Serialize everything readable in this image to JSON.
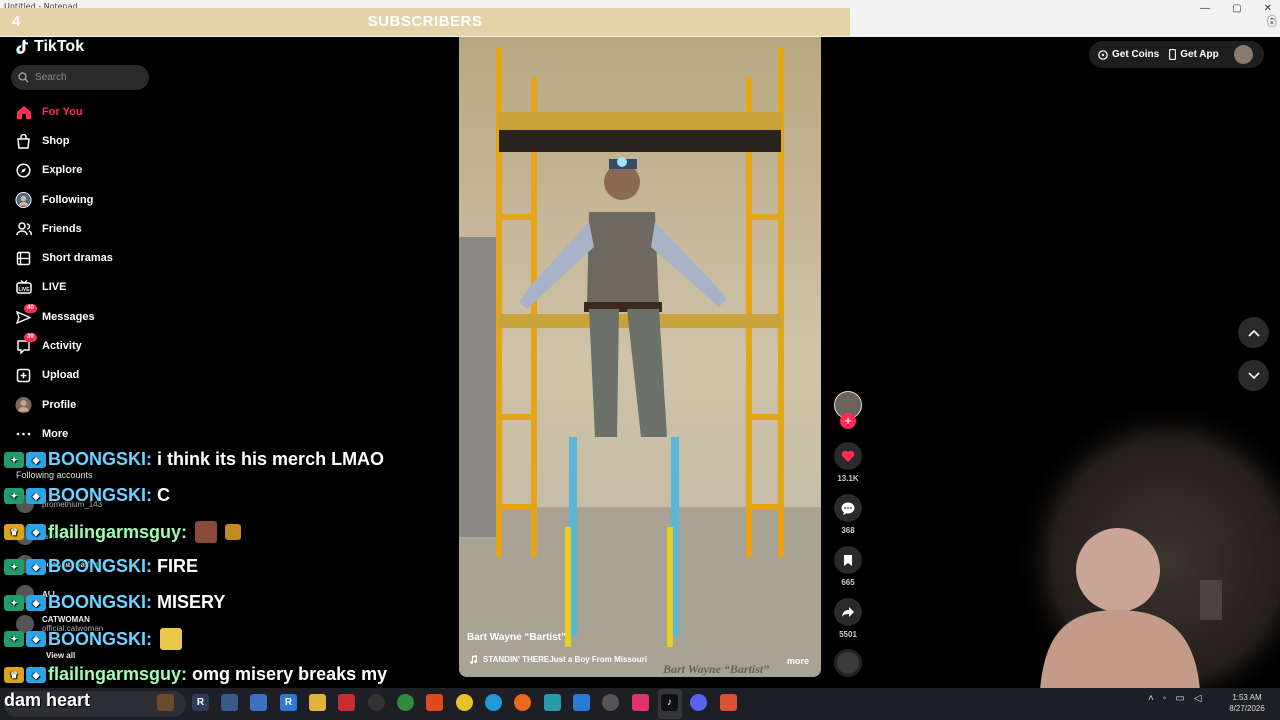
{
  "overlay": {
    "left_count": "4",
    "banner": "SUBSCRIBERS",
    "right_count": "6"
  },
  "tiktok": {
    "logo": "TikTok",
    "search_placeholder": "Search",
    "nav": [
      {
        "label": "For You",
        "icon": "home-icon",
        "active": true
      },
      {
        "label": "Shop",
        "icon": "shop-icon"
      },
      {
        "label": "Explore",
        "icon": "compass-icon"
      },
      {
        "label": "Following",
        "icon": "following-avatar-icon"
      },
      {
        "label": "Friends",
        "icon": "friends-icon"
      },
      {
        "label": "Short dramas",
        "icon": "film-icon"
      },
      {
        "label": "LIVE",
        "icon": "live-icon"
      },
      {
        "label": "Messages",
        "icon": "messages-icon",
        "badge": "40"
      },
      {
        "label": "Activity",
        "icon": "activity-icon",
        "badge": "39"
      },
      {
        "label": "Upload",
        "icon": "upload-icon"
      },
      {
        "label": "Profile",
        "icon": "profile-avatar-icon"
      },
      {
        "label": "More",
        "icon": "more-icon"
      }
    ],
    "following_header": "Following accounts",
    "following_accounts": [
      {
        "name": "",
        "handle": "promethium_143"
      },
      {
        "name": "",
        "handle": "laurynyleo"
      },
      {
        "name": "sophiabroadcast",
        "handle": ""
      },
      {
        "name": "ALI",
        "handle": ""
      },
      {
        "name": "CATWOMAN",
        "handle": "official.catwoman"
      }
    ],
    "view_all": "View all",
    "top_right": {
      "coins": "Get Coins",
      "app": "Get App"
    },
    "video": {
      "author": "Bart Wayne “Bartist”",
      "music": "STANDIN' THEREJust a Boy From Missouri",
      "more": "more",
      "watermark": "Bart Wayne “Bartist”"
    },
    "actions": {
      "likes": "13.1K",
      "comments": "368",
      "saves": "665",
      "shares": "5501"
    }
  },
  "chat": [
    {
      "user": "BOONGSKI:",
      "message": "i think its his merch LMAO",
      "style": "u1"
    },
    {
      "user": "BOONGSKI:",
      "message": "C",
      "style": "u1"
    },
    {
      "user": "flailingarmsguy:",
      "message": "",
      "style": "u2",
      "emotes": 2
    },
    {
      "user": "BOONGSKI:",
      "message": "FIRE",
      "style": "u1"
    },
    {
      "user": "BOONGSKI:",
      "message": "MISERY",
      "style": "u1"
    },
    {
      "user": "BOONGSKI:",
      "message": "",
      "style": "u1",
      "emotes": 1
    },
    {
      "user": "flailingarmsguy:",
      "message": "omg misery breaks my",
      "style": "u2"
    }
  ],
  "chat_continuation": "dam heart",
  "window": {
    "tiny_title": "Untitled - Notepad"
  },
  "taskbar": {
    "time": "1:53 AM",
    "date": "8/27/2026"
  }
}
